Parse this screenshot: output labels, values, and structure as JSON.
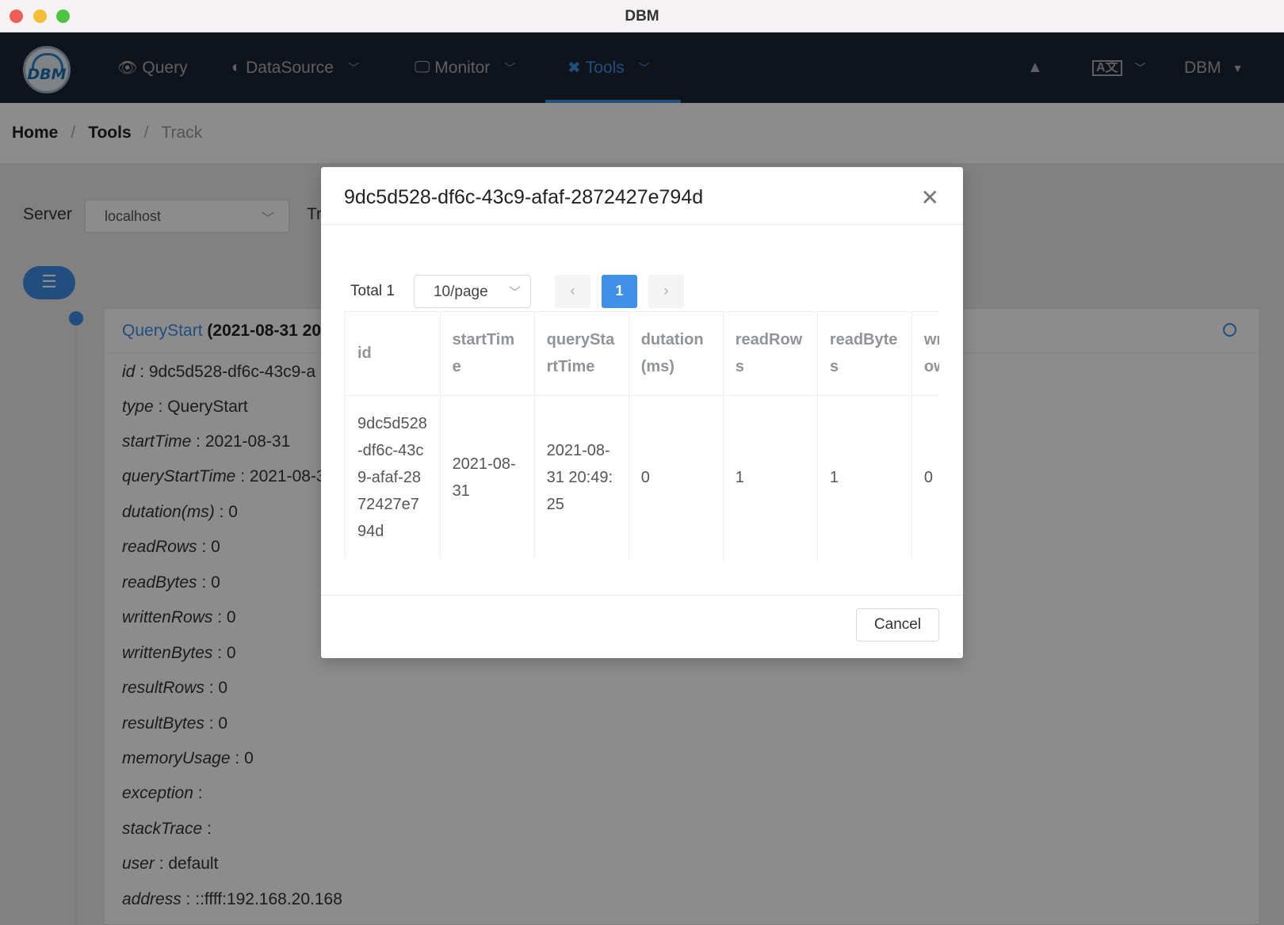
{
  "window": {
    "title": "DBM"
  },
  "nav": {
    "items": [
      {
        "label": "Query",
        "icon": "eye-icon"
      },
      {
        "label": "DataSource",
        "icon": "half-circle-icon"
      },
      {
        "label": "Monitor",
        "icon": "monitor-icon"
      },
      {
        "label": "Tools",
        "icon": "tools-icon",
        "active": true
      }
    ],
    "user": "DBM",
    "accent": "#3f8ee8"
  },
  "breadcrumb": {
    "home": "Home",
    "tools": "Tools",
    "current": "Track"
  },
  "page": {
    "server_label": "Server",
    "server_value": "localhost",
    "track_label_fragment": "Tr",
    "card_title": "QueryStart",
    "card_time": "(2021-08-31 20",
    "fields": [
      {
        "key": "id",
        "value": "9dc5d528-df6c-43c9-a"
      },
      {
        "key": "type",
        "value": "QueryStart"
      },
      {
        "key": "startTime",
        "value": "2021-08-31"
      },
      {
        "key": "queryStartTime",
        "value": "2021-08-3"
      },
      {
        "key": "dutation(ms)",
        "value": "0"
      },
      {
        "key": "readRows",
        "value": "0"
      },
      {
        "key": "readBytes",
        "value": "0"
      },
      {
        "key": "writtenRows",
        "value": "0"
      },
      {
        "key": "writtenBytes",
        "value": "0"
      },
      {
        "key": "resultRows",
        "value": "0"
      },
      {
        "key": "resultBytes",
        "value": "0"
      },
      {
        "key": "memoryUsage",
        "value": "0"
      },
      {
        "key": "exception",
        "value": ""
      },
      {
        "key": "stackTrace",
        "value": ""
      },
      {
        "key": "user",
        "value": "default"
      },
      {
        "key": "address",
        "value": "::ffff:192.168.20.168"
      }
    ]
  },
  "modal": {
    "title": "9dc5d528-df6c-43c9-afaf-2872427e794d",
    "total": "Total 1",
    "page_size": "10/page",
    "current_page": "1",
    "columns": [
      "id",
      "startTime",
      "queryStartTime",
      "dutation(ms)",
      "readRows",
      "readBytes",
      "writtenRows"
    ],
    "rows": [
      [
        "9dc5d528-df6c-43c9-afaf-2872427e794d",
        "2021-08-31",
        "2021-08-31 20:49:25",
        "0",
        "1",
        "1",
        "0"
      ]
    ],
    "cancel_label": "Cancel"
  }
}
